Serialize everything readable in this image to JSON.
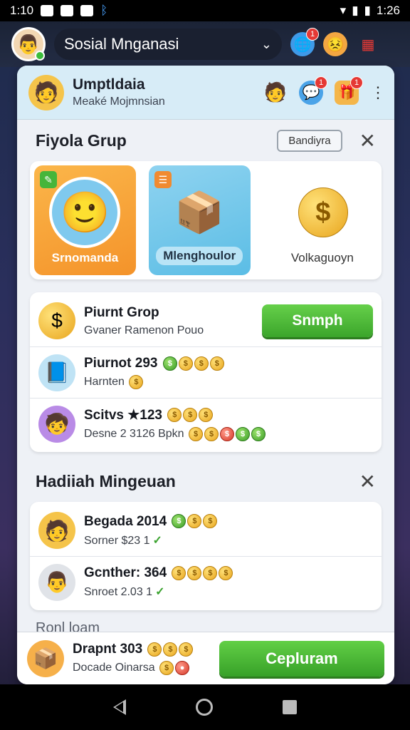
{
  "status": {
    "time_left": "1:10",
    "time_right": "1:26"
  },
  "app": {
    "title": "Sosial Mnganasi"
  },
  "header": {
    "title": "Umptldaia",
    "subtitle": "Meaké Mojmnsian"
  },
  "group_section": {
    "title": "Fiyola Grup",
    "action_label": "Bandiyra",
    "cards": [
      {
        "label": "Srnomanda",
        "art": "person-coin"
      },
      {
        "label": "Mlenghoulor",
        "art": "person-box"
      },
      {
        "label": "Volkaguoyn",
        "art": "coin-ribbon"
      }
    ]
  },
  "group_list": [
    {
      "title": "Piurnt Grop",
      "subtitle": "Gvaner Ramenon Pouo",
      "action": "Snmph"
    },
    {
      "title": "Piurnot 293",
      "subtitle": "Harnten",
      "coins": [
        "g",
        "y",
        "y",
        "y"
      ]
    },
    {
      "title": "Scitvs ★123",
      "subtitle": "Desne 2 3126 Bpkn",
      "coins": [
        "y",
        "y",
        "y"
      ]
    }
  ],
  "weekly_section": {
    "title": "Hadiiah Mingeuan"
  },
  "weekly_list": [
    {
      "title": "Begada 2014",
      "subtitle": "Sorner $23 1"
    },
    {
      "title": "Gcnther: 364",
      "subtitle": "Snroet 2.03 1"
    }
  ],
  "footer_label": "Ronl loam",
  "bottom": {
    "title": "Drapnt 303",
    "subtitle": "Docade Oinarsa",
    "button": "Cepluram"
  },
  "colors": {
    "accent_green": "#3ba52b",
    "panel_bg": "#eef1f6",
    "badge_red": "#e53935"
  }
}
